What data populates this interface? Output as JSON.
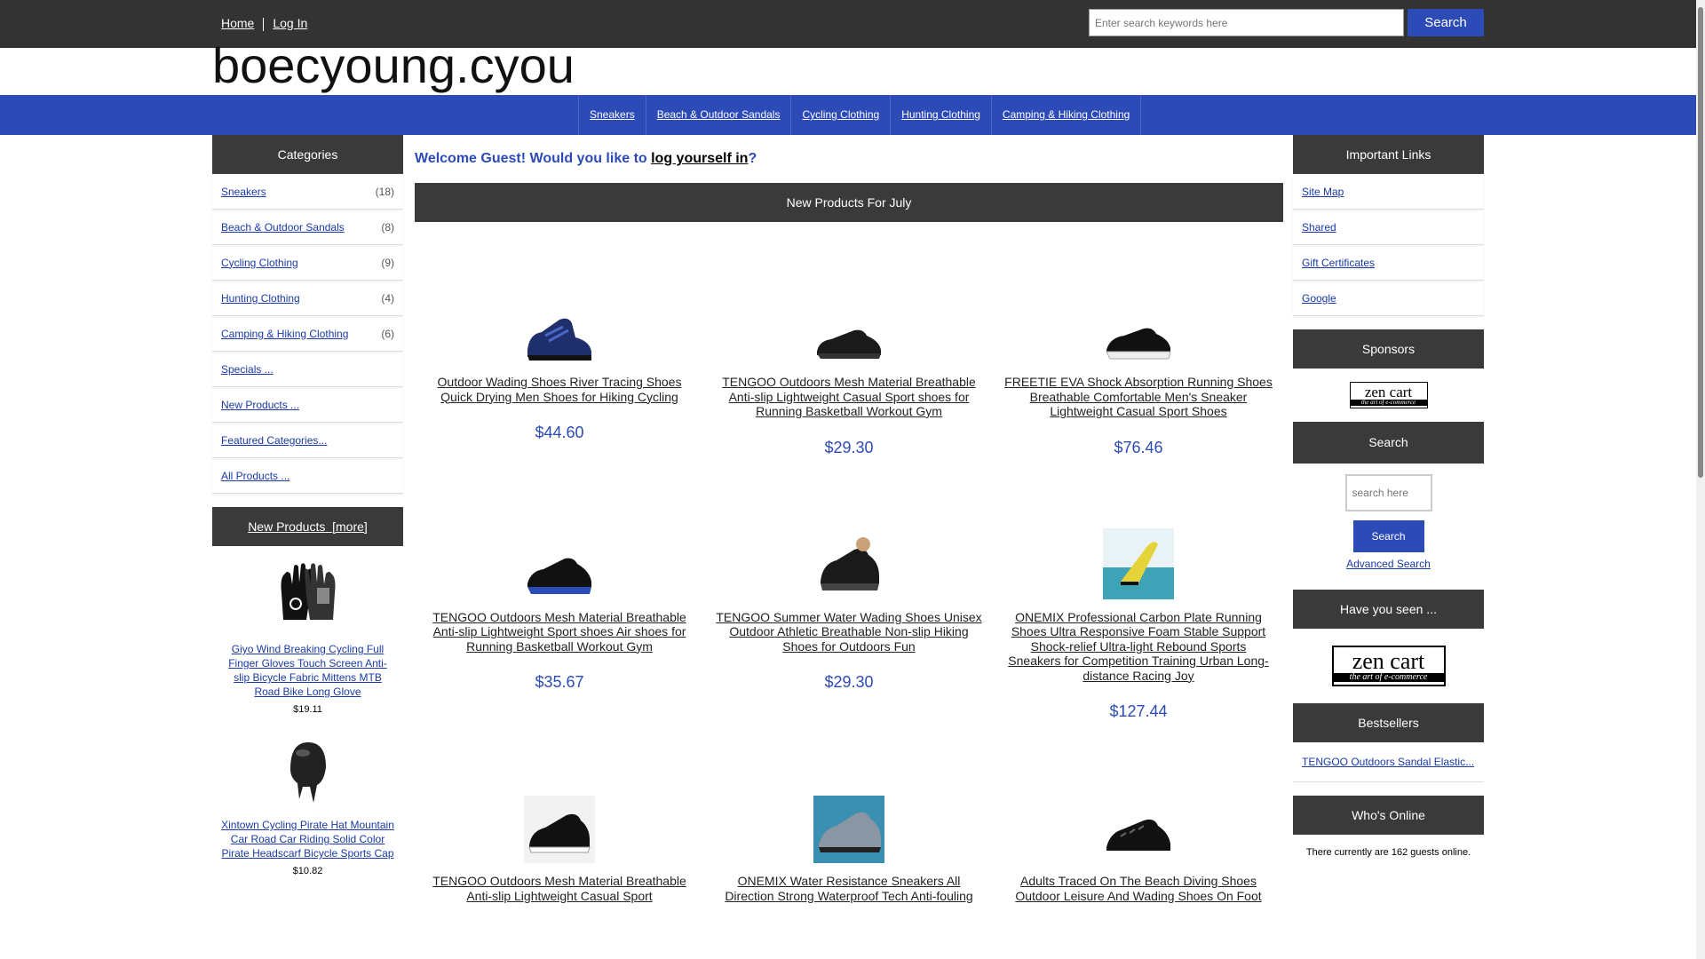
{
  "header": {
    "nav": [
      "Home",
      "Log In"
    ],
    "search_placeholder": "Enter search keywords here",
    "search_button": "Search",
    "site_name": "boecyoung.cyou"
  },
  "catbar": [
    "Sneakers",
    "Beach & Outdoor Sandals",
    "Cycling Clothing",
    "Hunting Clothing",
    "Camping & Hiking Clothing"
  ],
  "left": {
    "categories_title": "Categories",
    "categories": [
      {
        "label": "Sneakers",
        "count": "(18)"
      },
      {
        "label": "Beach & Outdoor Sandals",
        "count": "(8)"
      },
      {
        "label": "Cycling Clothing",
        "count": "(9)"
      },
      {
        "label": "Hunting Clothing",
        "count": "(4)"
      },
      {
        "label": "Camping & Hiking Clothing",
        "count": "(6)"
      },
      {
        "label": "Specials ...",
        "count": ""
      },
      {
        "label": "New Products ...",
        "count": ""
      },
      {
        "label": "Featured Categories...",
        "count": ""
      },
      {
        "label": "All Products ...",
        "count": ""
      }
    ],
    "new_products_title": "New Products",
    "new_products_more": "[more]",
    "new_products": [
      {
        "name": "Giyo Wind Breaking Cycling Full Finger Gloves Touch Screen Anti-slip Bicycle Fabric Mittens MTB Road Bike Long Glove",
        "price": "$19.11",
        "icon": "gloves-icon"
      },
      {
        "name": "Xintown Cycling Pirate Hat Mountain Car Road Car Riding Solid Color Pirate Headscarf Bicycle Sports Cap",
        "price": "$10.82",
        "icon": "cap-icon"
      }
    ]
  },
  "center": {
    "welcome_prefix": "Welcome Guest! Would you like to ",
    "welcome_link": "log yourself in",
    "welcome_suffix": "?",
    "section_title": "New Products For July",
    "products": [
      {
        "name": "Outdoor Wading Shoes River Tracing Shoes Quick Drying Men Shoes for Hiking Cycling",
        "price": "$44.60"
      },
      {
        "name": "TENGOO Outdoors Mesh Material Breathable Anti-slip Lightweight Casual Sport shoes for Running Basketball Workout Gym",
        "price": "$29.30"
      },
      {
        "name": "FREETIE EVA Shock Absorption Running Shoes Breathable Comfortable Men's Sneaker Lightweight Casual Sport Shoes",
        "price": "$76.46"
      },
      {
        "name": "TENGOO Outdoors Mesh Material Breathable Anti-slip Lightweight Sport shoes Air shoes for Running Basketball Workout Gym",
        "price": "$35.67"
      },
      {
        "name": "TENGOO Summer Water Wading Shoes Unisex Outdoor Athletic Breathable Non-slip Hiking Shoes for Outdoors Fun",
        "price": "$29.30"
      },
      {
        "name": "ONEMIX Professional Carbon Plate Running Shoes Ultra Responsive Foam Stable Support Shock-relief Ultra-light Rebound Sports Sneakers for Competition Training Urban Long-distance Racing Joy",
        "price": "$127.44"
      },
      {
        "name": "TENGOO Outdoors Mesh Material Breathable Anti-slip Lightweight Casual Sport",
        "price": ""
      },
      {
        "name": "ONEMIX Water Resistance Sneakers All Direction Strong Waterproof Tech Anti-fouling",
        "price": ""
      },
      {
        "name": "Adults Traced On The Beach Diving Shoes Outdoor Leisure And Wading Shoes On Foot",
        "price": ""
      }
    ]
  },
  "right": {
    "links_title": "Important Links",
    "links": [
      "Site Map",
      "Shared",
      "Gift Certificates",
      "Google"
    ],
    "sponsors_title": "Sponsors",
    "zencart_logo": {
      "name": "zen cart",
      "tagline": "the art of e-commerce"
    },
    "search_title": "Search",
    "search_placeholder": "search here",
    "search_button": "Search",
    "advanced_search": "Advanced Search",
    "seen_title": "Have you seen ...",
    "bestsellers_title": "Bestsellers",
    "bestseller": "TENGOO Outdoors Sandal Elastic...",
    "online_title": "Who's Online",
    "online_text": "There currently are 162 guests online."
  }
}
